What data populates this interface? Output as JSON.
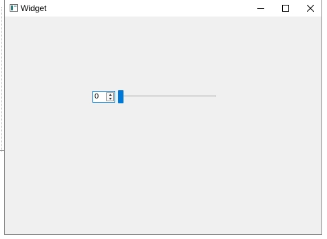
{
  "window": {
    "title": "Widget",
    "icon": "app-window-icon",
    "controls": {
      "minimize_icon": "minimize-icon",
      "maximize_icon": "maximize-icon",
      "close_icon": "close-icon"
    }
  },
  "spinbox": {
    "value": "0"
  },
  "slider": {
    "value": 0,
    "minimum": 0,
    "maximum": 99
  },
  "colors": {
    "accent": "#0078d7",
    "client_background": "#f0f0f0",
    "title_bar_background": "#ffffff"
  }
}
